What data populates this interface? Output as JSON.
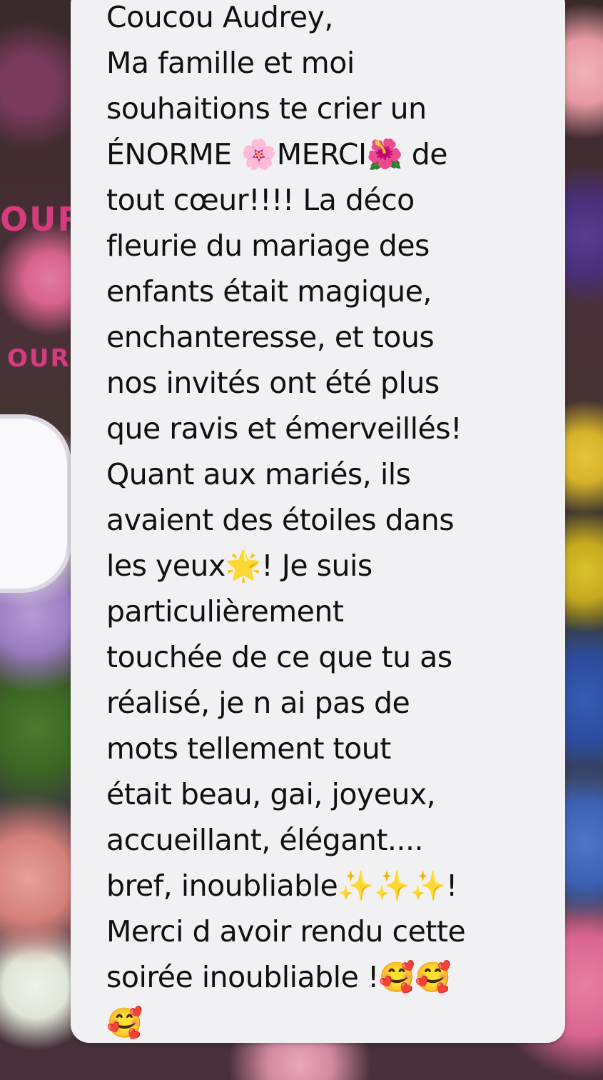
{
  "background": {
    "stamp_text_1": "OUR",
    "stamp_text_2": "OUR"
  },
  "message": {
    "text": "Coucou Audrey,\nMa famille et moi\nsouhaitions te crier un\nÉNORME 🌸MERCI🌺 de\ntout cœur!!!! La déco\nfleurie du mariage des\nenfants était magique,\nenchanteresse, et tous\nnos invités ont été plus\nque ravis et émerveillés!\nQuant aux mariés, ils\navaient des étoiles dans\nles yeux🌟! Je suis\nparticulièrement\ntouchée de ce que tu as\nréalisé, je n ai pas de\nmots tellement tout\nétait beau, gai, joyeux,\naccueillant, élégant....\nbref, inoubliable✨✨✨!\nMerci d avoir rendu cette\nsoirée inoubliable !🥰🥰\n🥰"
  }
}
